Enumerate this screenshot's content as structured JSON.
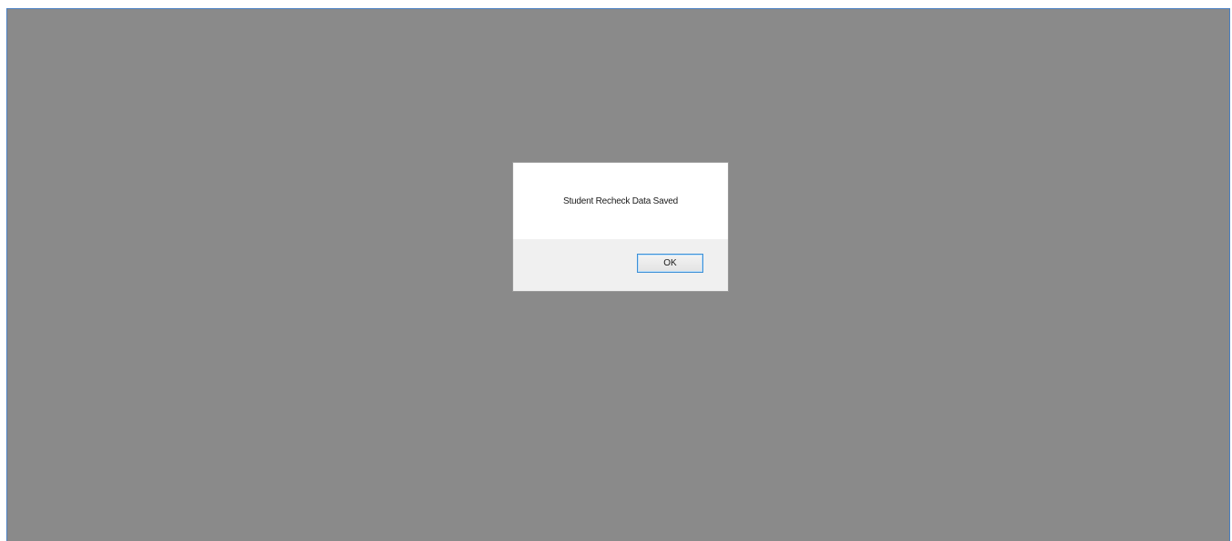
{
  "dialog": {
    "message": "Student Recheck Data Saved",
    "ok_label": "OK"
  },
  "colors": {
    "overlay": "#8a8a8a",
    "dialog_body": "#ffffff",
    "dialog_footer": "#f0f0f0",
    "button_focus_border": "#3c8fd6",
    "window_border": "#4a7fc1"
  }
}
